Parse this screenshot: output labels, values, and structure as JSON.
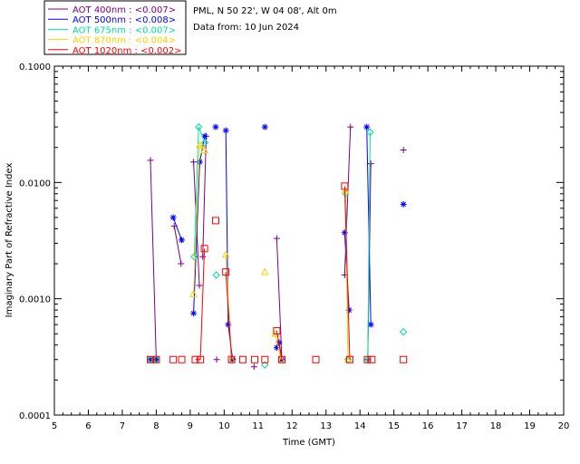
{
  "header": {
    "site": "PML, N 50 22', W 04 08', Alt 0m",
    "date": "Data from: 10 Jun 2024"
  },
  "colors": {
    "aot400": "#800080",
    "aot500": "#0000ff",
    "aot675": "#00e0a0",
    "aot870": "#ffd000",
    "aot1020": "#ff0000"
  },
  "chart_data": {
    "type": "scatter",
    "xlabel": "Time (GMT)",
    "ylabel": "Imaginary Part of Refractive Index",
    "xlim": [
      5,
      20
    ],
    "ylim": [
      0.0001,
      0.1
    ],
    "yscale": "log",
    "x_ticks": [
      "5",
      "6",
      "7",
      "8",
      "9",
      "10",
      "11",
      "12",
      "13",
      "14",
      "15",
      "16",
      "17",
      "18",
      "19",
      "20"
    ],
    "y_ticks": [
      {
        "value": 0.0001,
        "label": "0.0001"
      },
      {
        "value": 0.001,
        "label": "0.0010"
      },
      {
        "value": 0.01,
        "label": "0.0100"
      },
      {
        "value": 0.1,
        "label": "0.1000"
      }
    ],
    "legend_position": "top-left",
    "series": [
      {
        "name": "AOT  400nm : <0.007>",
        "marker": "plus",
        "color_key": "aot400",
        "lines": [
          [
            [
              7.83,
              0.0155
            ],
            [
              8.0,
              0.0003
            ]
          ],
          [
            [
              8.53,
              0.0042
            ],
            [
              8.73,
              0.002
            ]
          ],
          [
            [
              9.1,
              0.015
            ],
            [
              9.27,
              0.0013
            ]
          ],
          [
            [
              9.37,
              0.0023
            ],
            [
              9.47,
              0.025
            ]
          ],
          [
            [
              11.55,
              0.0033
            ],
            [
              11.7,
              0.0003
            ]
          ],
          [
            [
              13.55,
              0.0016
            ],
            [
              13.72,
              0.03
            ]
          ],
          [
            [
              14.23,
              0.0003
            ],
            [
              14.32,
              0.0145
            ]
          ]
        ],
        "points": [
          {
            "x": 7.83,
            "y": 0.0155
          },
          {
            "x": 8.0,
            "y": 0.0003
          },
          {
            "x": 8.53,
            "y": 0.0042
          },
          {
            "x": 8.73,
            "y": 0.002
          },
          {
            "x": 9.1,
            "y": 0.015
          },
          {
            "x": 9.27,
            "y": 0.0013
          },
          {
            "x": 9.37,
            "y": 0.0023
          },
          {
            "x": 9.47,
            "y": 0.025
          },
          {
            "x": 9.78,
            "y": 0.0003
          },
          {
            "x": 10.25,
            "y": 0.0003
          },
          {
            "x": 10.88,
            "y": 0.00026
          },
          {
            "x": 11.55,
            "y": 0.0033
          },
          {
            "x": 11.7,
            "y": 0.0003
          },
          {
            "x": 13.55,
            "y": 0.0016
          },
          {
            "x": 13.72,
            "y": 0.03
          },
          {
            "x": 14.23,
            "y": 0.0003
          },
          {
            "x": 14.32,
            "y": 0.0145
          },
          {
            "x": 15.28,
            "y": 0.019
          }
        ]
      },
      {
        "name": "AOT  500nm : <0.008>",
        "marker": "asterisk",
        "color_key": "aot500",
        "lines": [
          [
            [
              7.83,
              0.0003
            ],
            [
              8.0,
              0.0003
            ]
          ],
          [
            [
              8.5,
              0.005
            ],
            [
              8.75,
              0.0032
            ]
          ],
          [
            [
              9.1,
              0.00075
            ],
            [
              9.28,
              0.015
            ],
            [
              9.43,
              0.025
            ]
          ],
          [
            [
              10.05,
              0.028
            ],
            [
              10.12,
              0.0006
            ],
            [
              10.25,
              0.0003
            ]
          ],
          [
            [
              11.55,
              0.00038
            ],
            [
              11.62,
              0.00042
            ],
            [
              11.7,
              0.0003
            ]
          ],
          [
            [
              13.55,
              0.0037
            ],
            [
              13.68,
              0.0008
            ]
          ],
          [
            [
              14.2,
              0.03
            ],
            [
              14.32,
              0.0006
            ]
          ]
        ],
        "points": [
          {
            "x": 7.83,
            "y": 0.0003
          },
          {
            "x": 8.0,
            "y": 0.0003
          },
          {
            "x": 8.5,
            "y": 0.005
          },
          {
            "x": 8.75,
            "y": 0.0032
          },
          {
            "x": 9.1,
            "y": 0.00075
          },
          {
            "x": 9.28,
            "y": 0.015
          },
          {
            "x": 9.43,
            "y": 0.025
          },
          {
            "x": 9.75,
            "y": 0.03
          },
          {
            "x": 10.05,
            "y": 0.028
          },
          {
            "x": 10.12,
            "y": 0.0006
          },
          {
            "x": 10.25,
            "y": 0.0003
          },
          {
            "x": 11.2,
            "y": 0.03
          },
          {
            "x": 11.55,
            "y": 0.00038
          },
          {
            "x": 11.62,
            "y": 0.00042
          },
          {
            "x": 11.7,
            "y": 0.0003
          },
          {
            "x": 13.55,
            "y": 0.0037
          },
          {
            "x": 13.68,
            "y": 0.0008
          },
          {
            "x": 14.2,
            "y": 0.03
          },
          {
            "x": 14.32,
            "y": 0.0006
          },
          {
            "x": 15.28,
            "y": 0.0065
          }
        ]
      },
      {
        "name": "AOT  675nm : <0.007>",
        "marker": "diamond",
        "color_key": "aot675",
        "lines": [
          [
            [
              7.83,
              0.0003
            ],
            [
              8.0,
              0.0003
            ]
          ],
          [
            [
              9.12,
              0.0023
            ],
            [
              9.25,
              0.03
            ],
            [
              9.43,
              0.022
            ]
          ],
          [
            [
              13.58,
              0.008
            ],
            [
              13.65,
              0.0003
            ]
          ],
          [
            [
              14.23,
              0.0003
            ],
            [
              14.3,
              0.027
            ]
          ]
        ],
        "points": [
          {
            "x": 7.83,
            "y": 0.0003
          },
          {
            "x": 8.0,
            "y": 0.0003
          },
          {
            "x": 9.12,
            "y": 0.0023
          },
          {
            "x": 9.25,
            "y": 0.03
          },
          {
            "x": 9.43,
            "y": 0.022
          },
          {
            "x": 9.77,
            "y": 0.0016
          },
          {
            "x": 11.2,
            "y": 0.00027
          },
          {
            "x": 13.58,
            "y": 0.008
          },
          {
            "x": 13.65,
            "y": 0.0003
          },
          {
            "x": 14.23,
            "y": 0.0003
          },
          {
            "x": 14.3,
            "y": 0.027
          },
          {
            "x": 15.28,
            "y": 0.00052
          }
        ]
      },
      {
        "name": "AOT  870nm : <0.004>",
        "marker": "triangle",
        "color_key": "aot870",
        "lines": [
          [
            [
              9.1,
              0.0011
            ],
            [
              9.28,
              0.021
            ],
            [
              9.42,
              0.019
            ]
          ],
          [
            [
              10.05,
              0.0024
            ],
            [
              10.22,
              0.0003
            ]
          ],
          [
            [
              11.5,
              0.0005
            ],
            [
              11.68,
              0.0003
            ]
          ],
          [
            [
              13.57,
              0.0085
            ],
            [
              13.65,
              0.0003
            ]
          ]
        ],
        "points": [
          {
            "x": 9.1,
            "y": 0.0011
          },
          {
            "x": 9.28,
            "y": 0.021
          },
          {
            "x": 9.42,
            "y": 0.019
          },
          {
            "x": 10.05,
            "y": 0.0024
          },
          {
            "x": 10.22,
            "y": 0.0003
          },
          {
            "x": 11.2,
            "y": 0.0017
          },
          {
            "x": 11.5,
            "y": 0.0005
          },
          {
            "x": 11.68,
            "y": 0.0003
          },
          {
            "x": 13.57,
            "y": 0.0085
          },
          {
            "x": 13.65,
            "y": 0.0003
          }
        ]
      },
      {
        "name": "AOT 1020nm : <0.002>",
        "marker": "square",
        "color_key": "aot1020",
        "lines": [
          [
            [
              7.83,
              0.0003
            ],
            [
              8.0,
              0.0003
            ]
          ],
          [
            [
              9.15,
              0.0003
            ],
            [
              9.3,
              0.0003
            ],
            [
              9.42,
              0.0027
            ]
          ],
          [
            [
              10.05,
              0.0017
            ],
            [
              10.22,
              0.0003
            ]
          ],
          [
            [
              11.55,
              0.00053
            ],
            [
              11.7,
              0.0003
            ]
          ],
          [
            [
              13.55,
              0.0093
            ],
            [
              13.7,
              0.0003
            ]
          ]
        ],
        "points": [
          {
            "x": 7.83,
            "y": 0.0003
          },
          {
            "x": 8.0,
            "y": 0.0003
          },
          {
            "x": 8.5,
            "y": 0.0003
          },
          {
            "x": 8.75,
            "y": 0.0003
          },
          {
            "x": 9.15,
            "y": 0.0003
          },
          {
            "x": 9.3,
            "y": 0.0003
          },
          {
            "x": 9.42,
            "y": 0.0027
          },
          {
            "x": 9.75,
            "y": 0.0047
          },
          {
            "x": 10.05,
            "y": 0.0017
          },
          {
            "x": 10.22,
            "y": 0.0003
          },
          {
            "x": 10.55,
            "y": 0.0003
          },
          {
            "x": 10.9,
            "y": 0.0003
          },
          {
            "x": 11.2,
            "y": 0.0003
          },
          {
            "x": 11.55,
            "y": 0.00053
          },
          {
            "x": 11.7,
            "y": 0.0003
          },
          {
            "x": 12.7,
            "y": 0.0003
          },
          {
            "x": 13.55,
            "y": 0.0093
          },
          {
            "x": 13.7,
            "y": 0.0003
          },
          {
            "x": 14.22,
            "y": 0.0003
          },
          {
            "x": 14.35,
            "y": 0.0003
          },
          {
            "x": 15.28,
            "y": 0.0003
          }
        ]
      }
    ]
  }
}
